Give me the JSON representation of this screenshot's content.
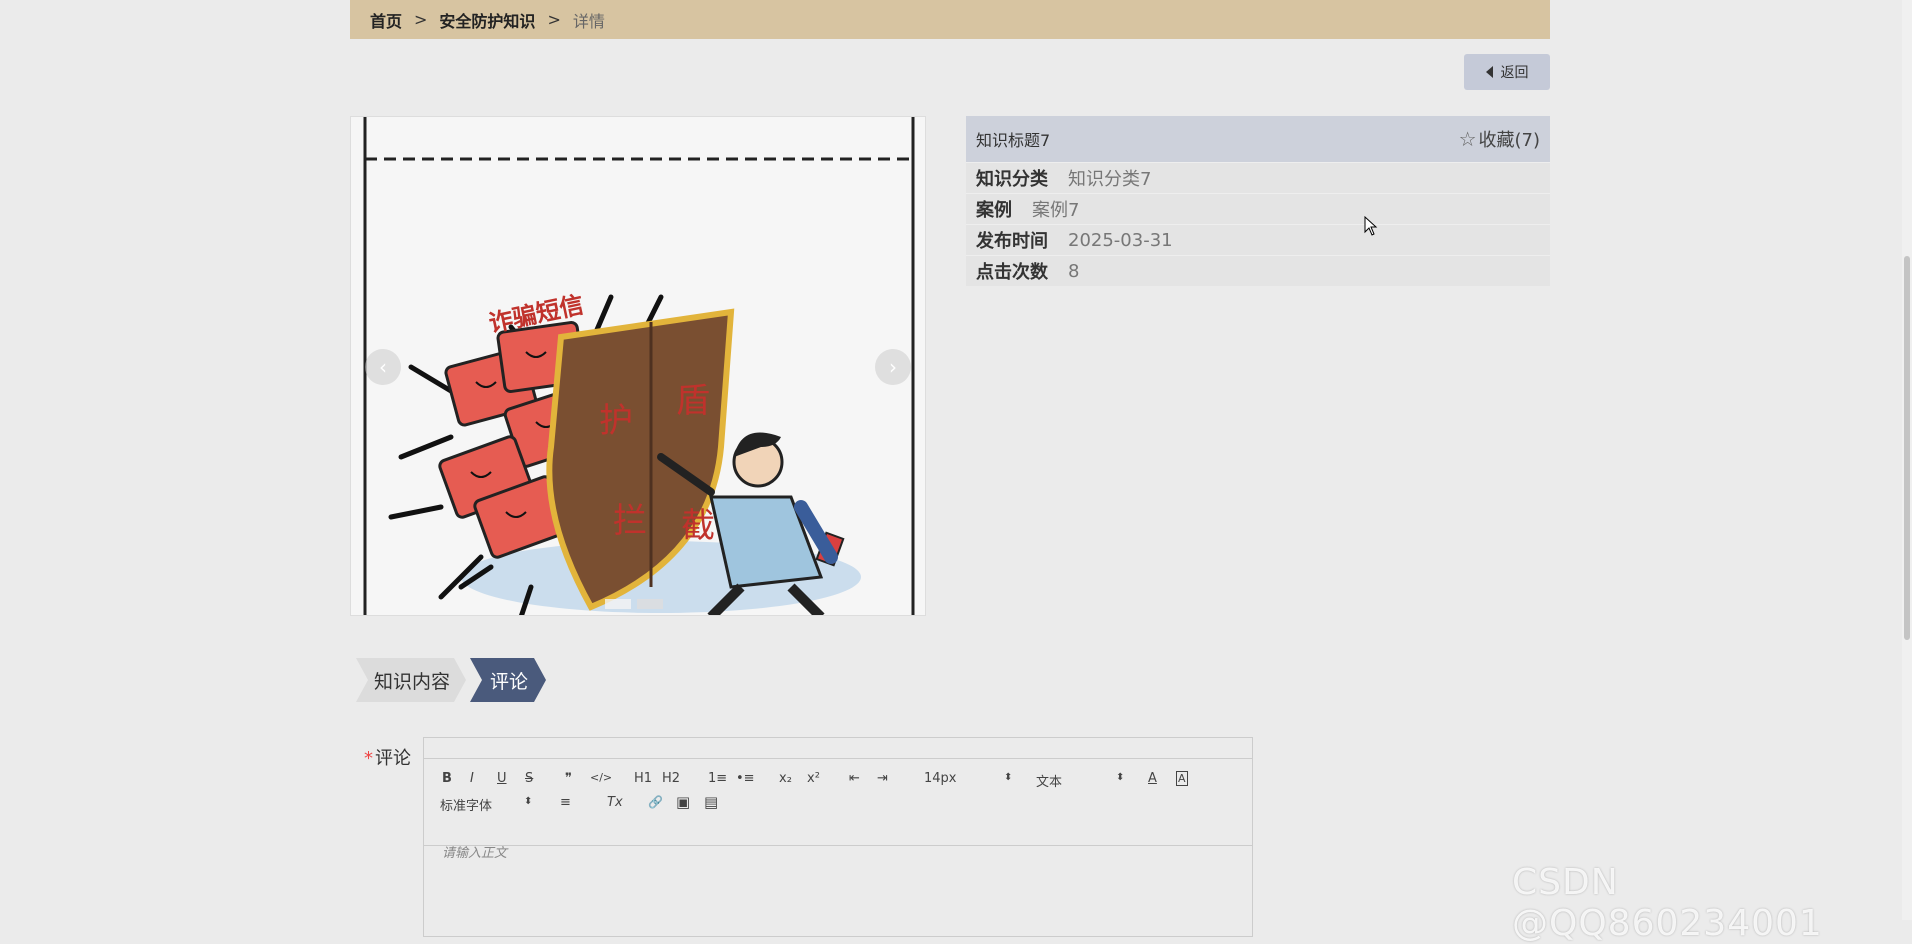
{
  "breadcrumb": {
    "home": "首页",
    "section": "安全防护知识",
    "current": "详情",
    "separator": ">"
  },
  "back_button": {
    "label": "返回",
    "icon": "caret-left-icon"
  },
  "carousel": {
    "image_text": {
      "top": "诈骗短信",
      "shield_1": "护",
      "shield_2": "盾",
      "shield_3": "拦",
      "shield_4": "截"
    },
    "prev_icon": "chevron-left-icon",
    "next_icon": "chevron-right-icon",
    "prev_glyph": "‹",
    "next_glyph": "›"
  },
  "info": {
    "title": "知识标题7",
    "favorite": {
      "label": "收藏(7)",
      "icon": "star-outline-icon",
      "glyph": "☆"
    },
    "rows": [
      {
        "label": "知识分类",
        "value": "知识分类7"
      },
      {
        "label": "案例",
        "value": "案例7"
      },
      {
        "label": "发布时间",
        "value": "2025-03-31"
      },
      {
        "label": "点击次数",
        "value": "8"
      }
    ]
  },
  "tabs": [
    {
      "label": "知识内容",
      "active": false
    },
    {
      "label": "评论",
      "active": true
    }
  ],
  "comment_form": {
    "label": "评论",
    "required_mark": "*",
    "font_size": "14px",
    "text_style": "文本",
    "font_family": "标准字体",
    "placeholder": "请输入正文",
    "toolbar": {
      "bold": "B",
      "italic": "I",
      "underline": "U",
      "strike": "S",
      "quote": "❞",
      "code": "</>",
      "h1": "H1",
      "h2": "H2",
      "ordered": "1≡",
      "bullet": "•≡",
      "sub": "x₂",
      "sup": "x²",
      "outdent": "⇤",
      "indent": "⇥",
      "color": "A",
      "bg": "A",
      "align": "≡",
      "clean": "Tx",
      "link": "🔗",
      "image": "▣",
      "video": "▤",
      "dropdown_arrow": "⬍"
    }
  },
  "watermark": "CSDN @QQ860234001",
  "colors": {
    "breadcrumb_bg": "#d7c4a1",
    "info_header_bg": "#cdd1db",
    "active_tab": "#4a5a7c",
    "page_bg": "#ebebeb"
  }
}
